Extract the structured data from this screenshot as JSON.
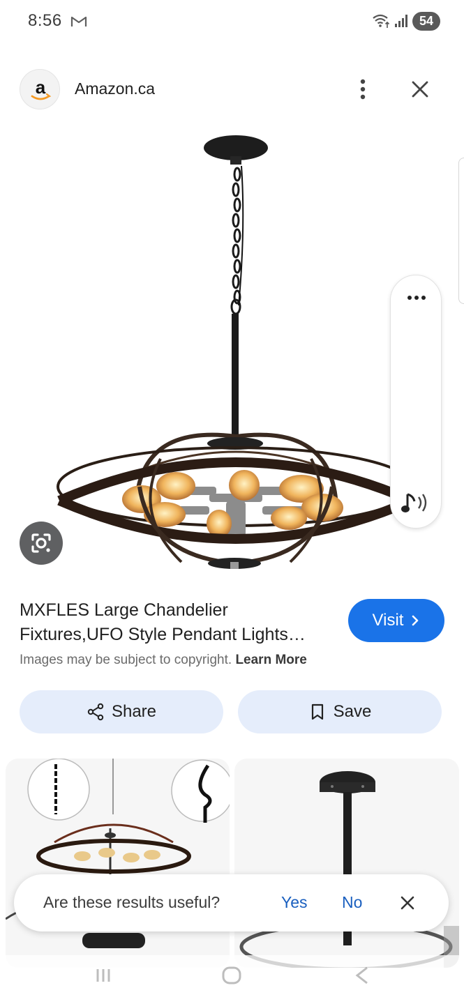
{
  "status_bar": {
    "time": "8:56",
    "battery": "54",
    "icons": [
      "gmail-icon",
      "wifi-icon",
      "signal-icon"
    ]
  },
  "header": {
    "site_name": "Amazon.ca",
    "logo_letter": "a",
    "icons": [
      "more-vertical-icon",
      "close-icon"
    ]
  },
  "image_viewer": {
    "subject": "chandelier",
    "side_panel_icons": [
      "more-horizontal-icon",
      "audio-icon"
    ],
    "lens_icon": "lens-icon"
  },
  "result": {
    "title": "MXFLES Large Chandelier Fixtures,UFO Style Pendant Lights Black Ceiling Light",
    "visit_label": "Visit",
    "copyright_text": "Images may be subject to copyright.",
    "learn_more": "Learn More"
  },
  "actions": {
    "share_label": "Share",
    "save_label": "Save"
  },
  "feedback": {
    "question": "Are these results useful?",
    "yes": "Yes",
    "no": "No"
  },
  "colors": {
    "accent": "#1a73e8",
    "action_bg": "#e5edfb",
    "link_blue": "#1a5fbf"
  }
}
